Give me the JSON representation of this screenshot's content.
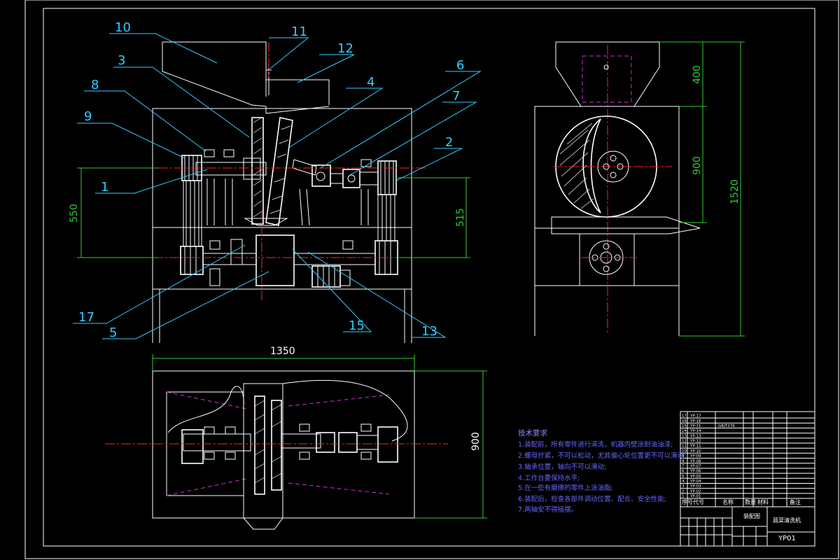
{
  "drawing": {
    "number": "YP01",
    "title_cells": [
      "装配图",
      "蔬菜清洗机"
    ],
    "part_labels": [
      "10",
      "11",
      "12",
      "3",
      "4",
      "8",
      "9",
      "6",
      "7",
      "2",
      "1",
      "17",
      "5",
      "15",
      "13"
    ],
    "dimensions": {
      "front_left": "550",
      "front_right": "515",
      "top_width": "1350",
      "top_right": "900",
      "side_hopper": "400",
      "side_mid": "900",
      "side_total": "1520"
    }
  },
  "technical_requirements": {
    "title": "技术要求",
    "items": [
      "1.装配前，所有零件进行清洗，机器内壁涂耐油油漆;",
      "2.螺母拧紧，不可以松动，尤其偏心轮位置更不可以滑动;",
      "3.轴承位置，轴向不可以滑动;",
      "4.工作台要保持水平;",
      "5.在一些有磨擦的零件上涂油脂;",
      "6.装配后，检查各部件调动位置、配合、安全性能;",
      "7.两轴安不得摇摆。"
    ]
  },
  "bom_rows": [
    [
      "17",
      "YP-17",
      "",
      "",
      ""
    ],
    [
      "16",
      "YP-16",
      "",
      "",
      ""
    ],
    [
      "15",
      "YP-15",
      "GB/T276",
      "",
      ""
    ],
    [
      "14",
      "YP-14",
      "",
      "",
      ""
    ],
    [
      "13",
      "YP-13",
      "",
      "",
      ""
    ],
    [
      "12",
      "YP-12",
      "",
      "",
      ""
    ],
    [
      "11",
      "YP-11",
      "",
      "",
      ""
    ],
    [
      "10",
      "YP-10",
      "",
      "",
      ""
    ],
    [
      "9",
      "YP-09",
      "",
      "",
      ""
    ],
    [
      "8",
      "YP-08",
      "",
      "",
      ""
    ],
    [
      "7",
      "YP-07",
      "",
      "",
      ""
    ],
    [
      "6",
      "YP-06",
      "",
      "",
      ""
    ],
    [
      "5",
      "YP-05",
      "",
      "",
      ""
    ],
    [
      "4",
      "YP-04",
      "",
      "",
      ""
    ],
    [
      "3",
      "YP-03",
      "",
      "",
      ""
    ],
    [
      "2",
      "YP-02",
      "",
      "",
      ""
    ],
    [
      "1",
      "YP-01",
      "",
      "",
      ""
    ]
  ],
  "bom_header": [
    "序号",
    "代号",
    "名称",
    "数量",
    "材料",
    "备注"
  ]
}
